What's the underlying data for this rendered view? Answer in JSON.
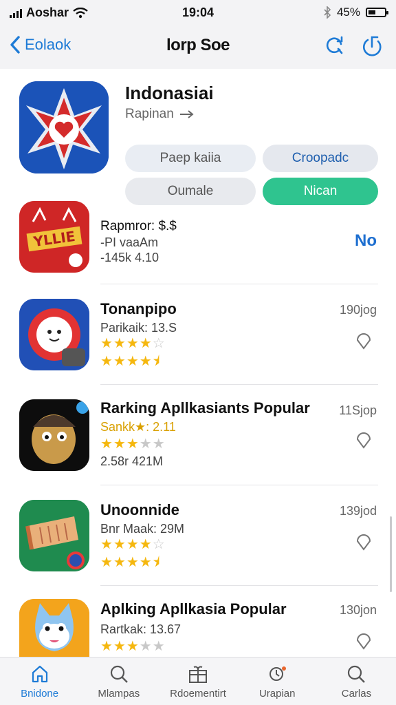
{
  "status_bar": {
    "carrier": "Aoshar",
    "time": "19:04",
    "battery": "45%"
  },
  "nav": {
    "back_label": "Eolaok",
    "title": "lorp Soe"
  },
  "hero": {
    "name": "Indonasiai",
    "subtitle": "Rapinan",
    "pills": [
      "Paep kaiia",
      "Croopadc",
      "Oumale",
      "Nican"
    ]
  },
  "apps": [
    {
      "name": "Rapmror: $.$",
      "line1": "-PI vaaAm",
      "line2": "-145k 4.10",
      "action": "No"
    },
    {
      "name": "Tonanpipo",
      "line1": "Parikaik: 13.S",
      "stars_a": 4,
      "stars_b": 4.5,
      "size": "190jog"
    },
    {
      "name": "Rarking Apllkasiants Popular",
      "line1": "Sankk★: 2.11",
      "stars_a": 3,
      "line2": "2.58r 421M",
      "size": "11Sjop"
    },
    {
      "name": "Unoonnide",
      "line1": "Bnr Maak: 29M",
      "stars_a": 4,
      "stars_b": 4.5,
      "size": "139jod"
    },
    {
      "name": "Aplking Apllkasia Popular",
      "line1": "Rartkak: 13.67",
      "stars_a": 3,
      "size": "130jon"
    }
  ],
  "tabs": [
    {
      "label": "Bnidone",
      "icon": "home-icon"
    },
    {
      "label": "Mlampas",
      "icon": "search-icon"
    },
    {
      "label": "Rdoementirt",
      "icon": "gift-icon"
    },
    {
      "label": "Urapian",
      "icon": "notification-icon"
    },
    {
      "label": "Carlas",
      "icon": "search-icon"
    }
  ],
  "colors": {
    "accent": "#1e7bd6",
    "green": "#2fc48f",
    "star": "#f5b70e"
  }
}
